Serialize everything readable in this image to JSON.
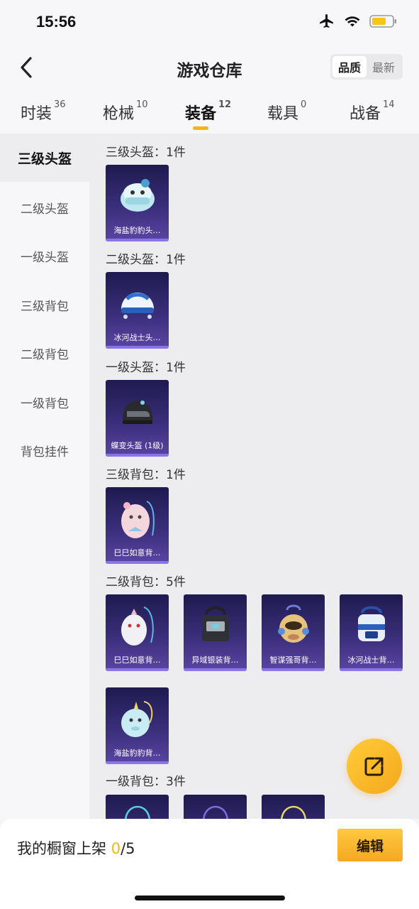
{
  "status": {
    "time": "15:56",
    "icons": [
      "airplane-icon",
      "wifi-icon",
      "battery-icon"
    ]
  },
  "header": {
    "title": "游戏仓库",
    "sort_options": [
      "品质",
      "最新"
    ],
    "selected_sort": "品质"
  },
  "tabs": [
    {
      "label": "时装",
      "count": "36"
    },
    {
      "label": "枪械",
      "count": "10"
    },
    {
      "label": "装备",
      "count": "12"
    },
    {
      "label": "载具",
      "count": "0"
    },
    {
      "label": "战备",
      "count": "14"
    }
  ],
  "active_tab": "装备",
  "sidebar": {
    "items": [
      "三级头盔",
      "二级头盔",
      "一级头盔",
      "三级背包",
      "二级背包",
      "一级背包",
      "背包挂件"
    ],
    "selected": "三级头盔"
  },
  "sections": [
    {
      "title": "三级头盔：1件",
      "items": [
        "海盐豹豹头…"
      ]
    },
    {
      "title": "二级头盔：1件",
      "items": [
        "冰河战士头…"
      ]
    },
    {
      "title": "一级头盔：1件",
      "items": [
        "蝶变头盔 (1级)"
      ]
    },
    {
      "title": "三级背包：1件",
      "items": [
        "巳巳如意背…"
      ]
    },
    {
      "title": "二级背包：5件",
      "items": [
        "巳巳如意背…",
        "异域银装背…",
        "智谋强哥背…",
        "冰河战士背…",
        "海盐豹豹背…"
      ]
    },
    {
      "title": "一级背包：3件",
      "items": [
        "",
        "",
        ""
      ]
    }
  ],
  "bottom": {
    "label": "我的橱窗上架 ",
    "current": "0",
    "total": "/5",
    "edit_label": "编辑"
  },
  "colors": {
    "accent": "#f5b416",
    "card_bg": "#2b2463"
  }
}
